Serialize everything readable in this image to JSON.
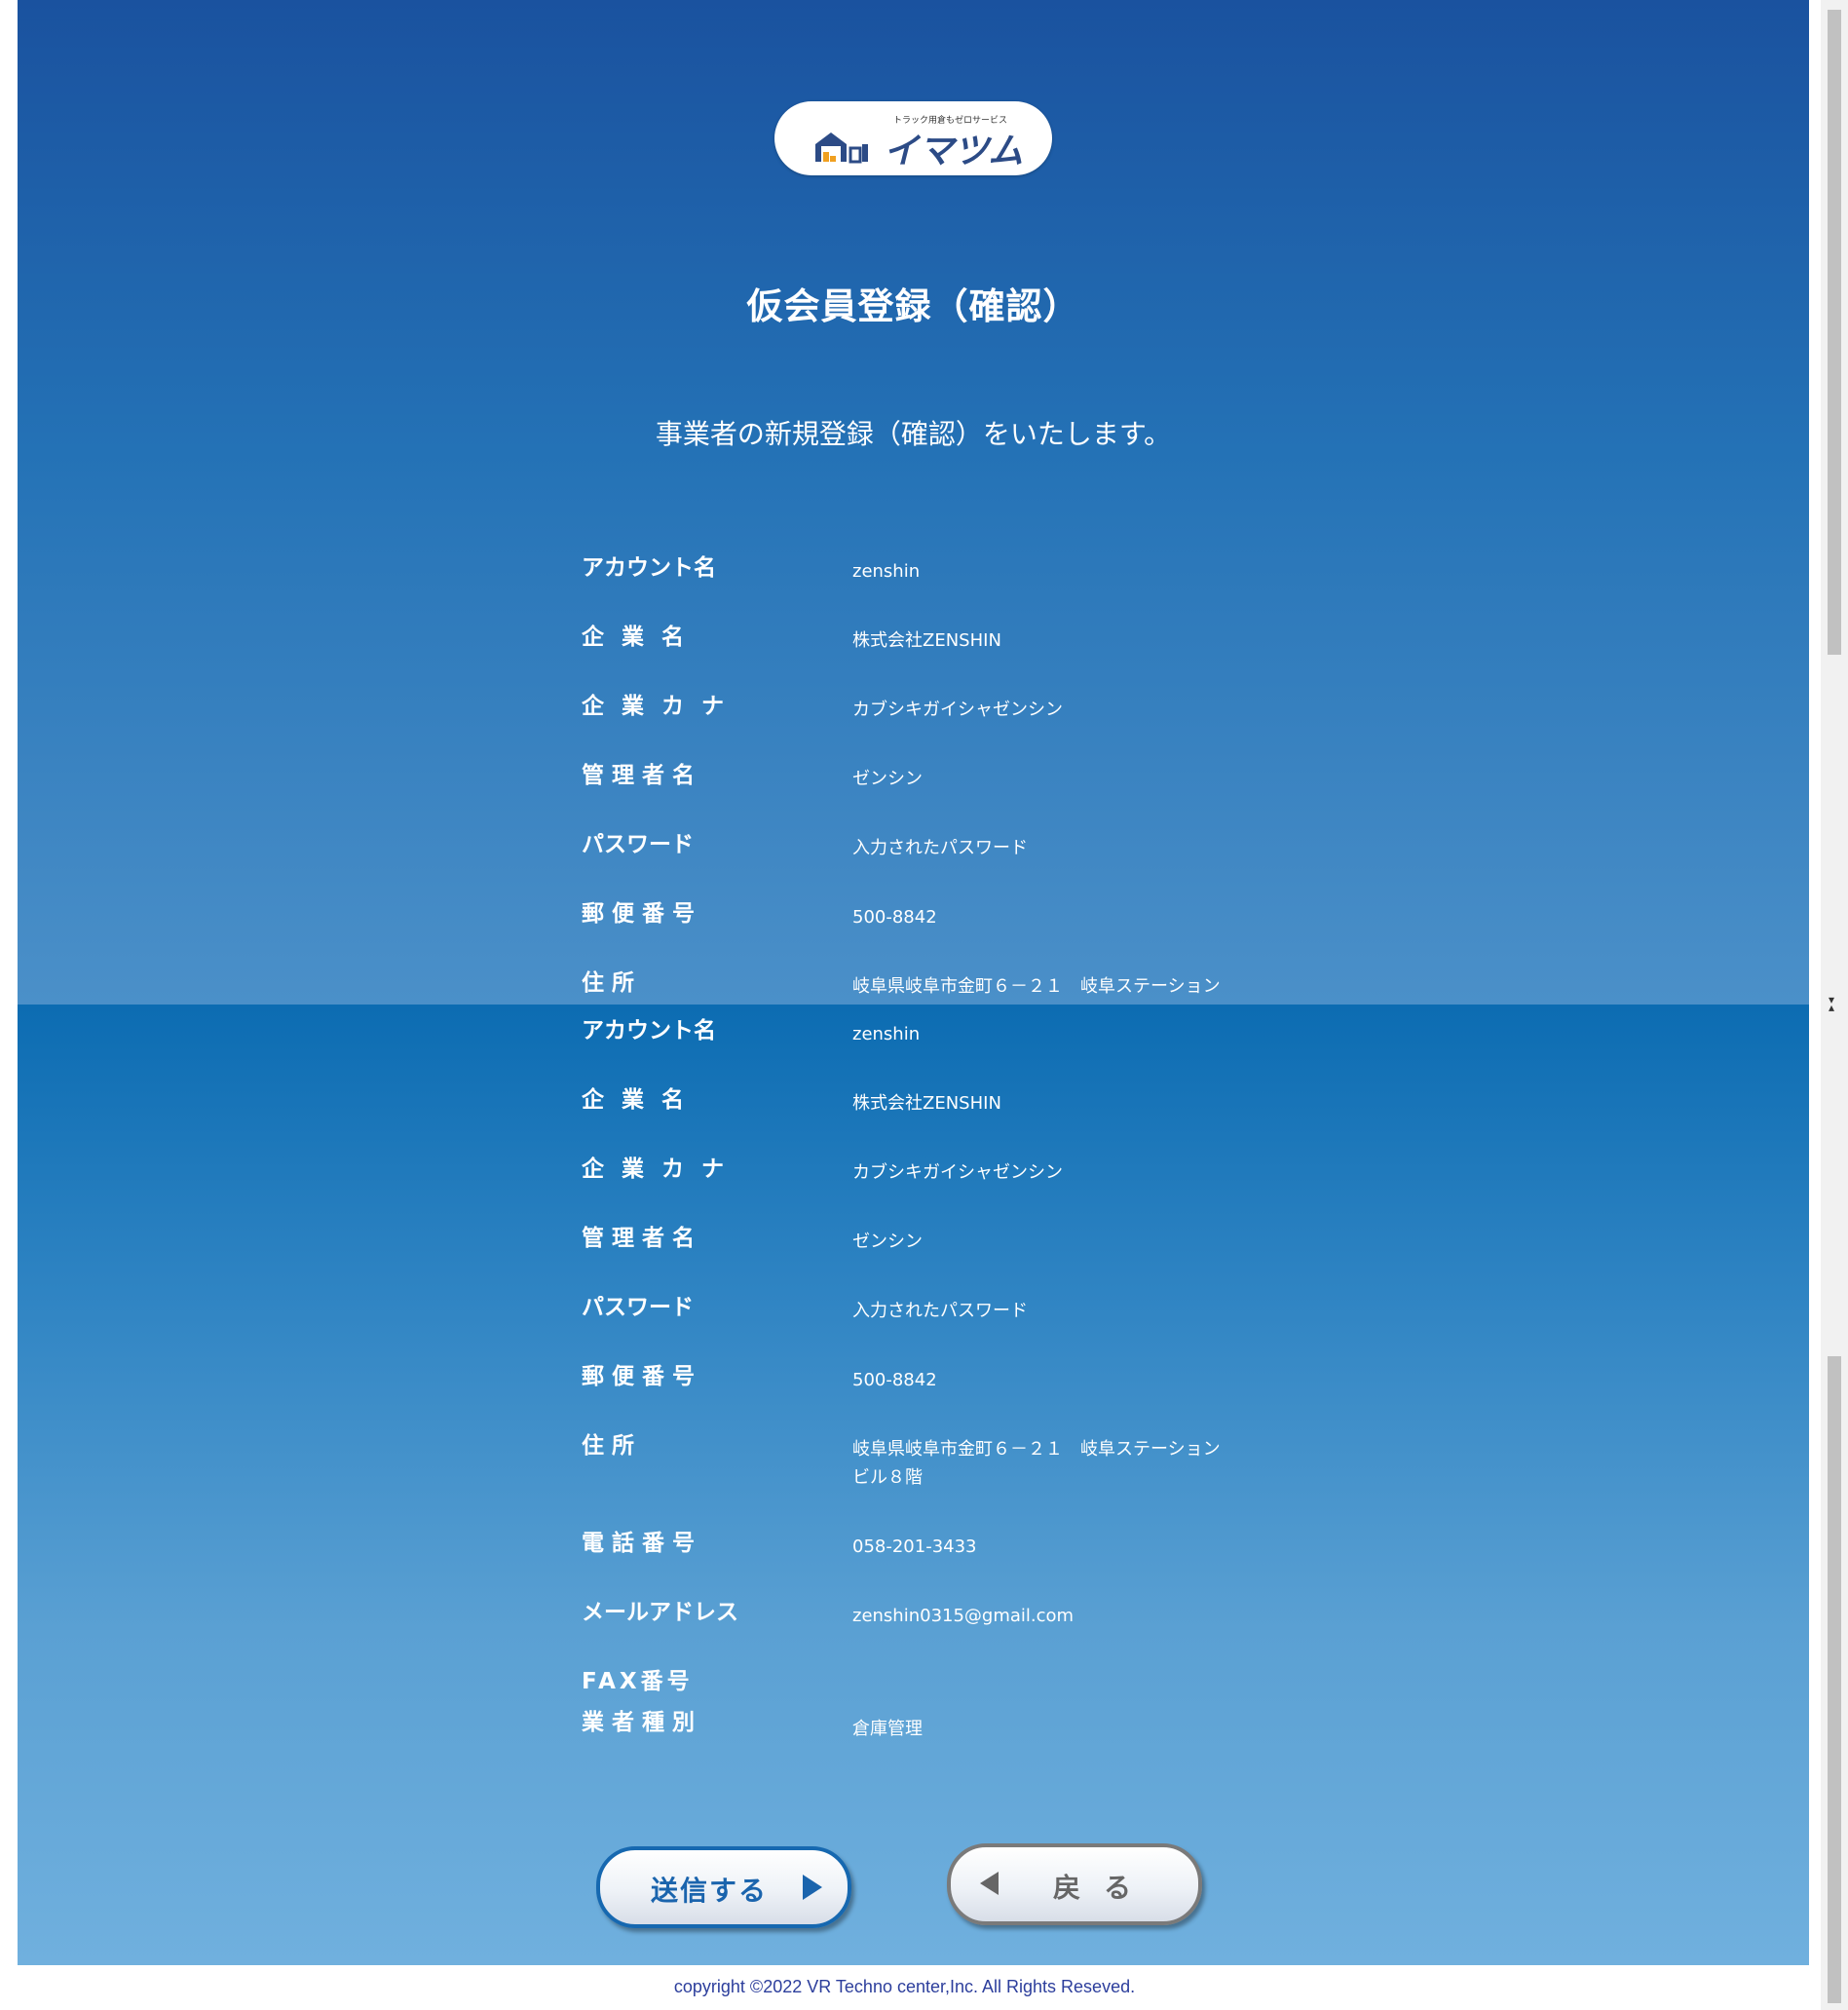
{
  "logo": {
    "tagline": "トラック用倉もゼロサービス",
    "wordmark": "イマツム"
  },
  "header": {
    "title": "仮会員登録（確認）",
    "lead": "事業者の新規登録（確認）をいたします。"
  },
  "top_rows": [
    {
      "label": "アカウント名",
      "value": "zenshin"
    },
    {
      "label": "企業名",
      "value": "株式会社ZENSHIN"
    },
    {
      "label": "企業カナ",
      "value": "カブシキガイシャゼンシン"
    },
    {
      "label": "管理者名",
      "value": "ゼンシン"
    },
    {
      "label": "パスワード",
      "value": "入力されたパスワード"
    },
    {
      "label": "郵便番号",
      "value": "500-8842"
    },
    {
      "label": "住所",
      "value": "岐阜県岐阜市金町６－２１　岐阜ステーション"
    }
  ],
  "rows": [
    {
      "label": "アカウント名",
      "value": "zenshin"
    },
    {
      "label": "企業名",
      "value": "株式会社ZENSHIN"
    },
    {
      "label": "企業カナ",
      "value": "カブシキガイシャゼンシン"
    },
    {
      "label": "管理者名",
      "value": "ゼンシン"
    },
    {
      "label": "パスワード",
      "value": "入力されたパスワード"
    },
    {
      "label": "郵便番号",
      "value": "500-8842"
    },
    {
      "label": "住所",
      "value": "岐阜県岐阜市金町６－２１　岐阜ステーション\nビル８階"
    },
    {
      "label": "電話番号",
      "value": "058-201-3433"
    },
    {
      "label": "メールアドレス",
      "value": "zenshin0315@gmail.com"
    },
    {
      "label": "FAX番号",
      "value": ""
    },
    {
      "label": "業者種別",
      "value": "倉庫管理"
    }
  ],
  "buttons": {
    "send_label": "送信する",
    "back_label": "戻る"
  },
  "footer": {
    "copyright": "copyright ©2022 VR Techno center,Inc. All Rights Reseved."
  }
}
